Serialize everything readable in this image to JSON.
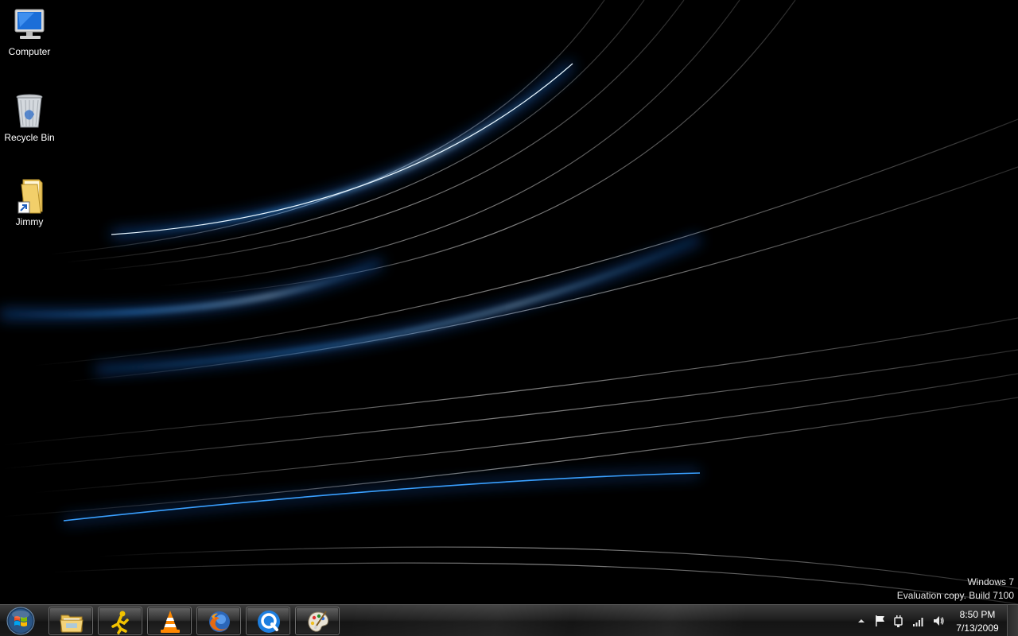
{
  "desktop": {
    "icons": [
      {
        "label": "Computer"
      },
      {
        "label": "Recycle Bin"
      },
      {
        "label": "Jimmy"
      }
    ],
    "watermark": {
      "line1": "Windows 7",
      "line2": "Evaluation copy. Build 7100"
    }
  },
  "taskbar": {
    "start_icon": "windows-orb-icon",
    "pinned": [
      {
        "icon": "windows-explorer-icon"
      },
      {
        "icon": "aim-running-man-icon"
      },
      {
        "icon": "vlc-cone-icon"
      },
      {
        "icon": "firefox-icon"
      },
      {
        "icon": "quicktime-icon"
      },
      {
        "icon": "paint-palette-icon"
      }
    ],
    "tray": {
      "icons": [
        "show-hidden-icons-arrow",
        "action-center-flag-icon",
        "power-plug-icon",
        "network-signal-icon",
        "volume-icon"
      ],
      "time": "8:50 PM",
      "date": "7/13/2009"
    }
  },
  "colors": {
    "streak_blue": "#3aa0ff",
    "streak_white": "#d8d8d8",
    "background": "#000000"
  }
}
